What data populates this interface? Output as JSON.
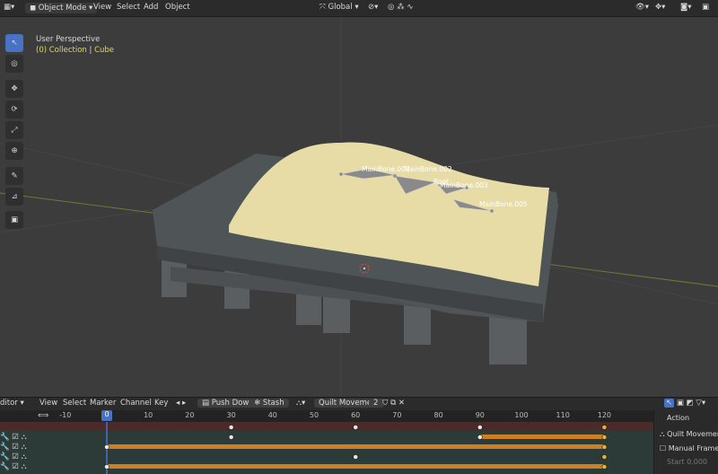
{
  "header": {
    "mode": "Object Mode",
    "menus": [
      "View",
      "Select",
      "Add",
      "Object"
    ],
    "transform": "Global"
  },
  "viewport": {
    "perspective": "User Perspective",
    "collection": "(0) Collection",
    "separator": "|",
    "object": "Cube",
    "bones": [
      "MainBone.001",
      "MainBone.002",
      "MainBone.003",
      "MainBone.005",
      "Root"
    ]
  },
  "timeline": {
    "editor": "ditor",
    "menus": [
      "View",
      "Select",
      "Marker",
      "Channel",
      "Key"
    ],
    "push_down": "Push Down",
    "stash": "Stash",
    "action": "Quilt Movement",
    "users": "2",
    "ruler": [
      "-10",
      "0",
      "10",
      "20",
      "30",
      "40",
      "50",
      "60",
      "70",
      "80",
      "90",
      "100",
      "110",
      "120"
    ],
    "current_frame": "0",
    "track_keys": [
      [
        30,
        60,
        90,
        120
      ],
      [
        30,
        90,
        120
      ],
      [
        0,
        120
      ],
      [
        60,
        120
      ],
      [
        0,
        120
      ]
    ]
  },
  "sidebar": {
    "title": "Action",
    "action_name": "Quilt Movemen",
    "manual_range": "Manual Frame Ra",
    "start_label": "Start",
    "start_value": "0.000"
  },
  "colors": {
    "accent": "#4a72c4",
    "quilt": "#e8dca6",
    "mattress": "#4f5456",
    "bar": "#cf7f23",
    "key": "#e0b33a"
  }
}
